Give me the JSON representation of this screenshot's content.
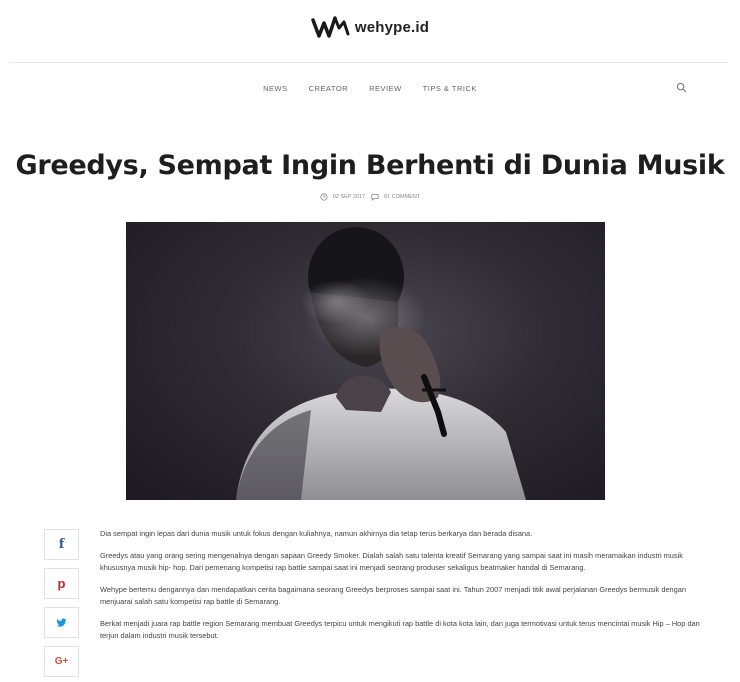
{
  "brand": {
    "logo_text": "wehype.id"
  },
  "nav": {
    "items": [
      "NEWS",
      "CREATOR",
      "REVIEW",
      "TIPS & TRICK"
    ],
    "search_icon": "search-icon"
  },
  "article": {
    "title": "Greedys, Sempat Ingin Berhenti di Dunia Musik",
    "date": "02 SEP 2017",
    "comments": "01 COMMENT",
    "paragraphs": [
      "Dia sempat ingin lepas dari dunia musik untuk fokus dengan kuliahnya, namun akhirnya dia tetap  terus berkarya dan berada disana.",
      "Greedys atau yang orang sering mengenalnya dengan sapaan Greedy Smoker. Dialah salah satu talenta kreatif Semarang yang sampai saat ini masih meramaikan industri musik khususnya musik hip- hop. Dari pemenang kompetisi rap battle sampai saat ini menjadi seorang produser sekaligus beatmaker handal di Semarang.",
      "Wehype bertemu dengannya dan mendapatkan cerita bagaimana seorang Greedys berproses sampai saat ini. Tahun 2007 menjadi titik awal perjalanan Greedys bermusik dengan menjuarai salah satu kompetisi rap battle di Semarang.",
      "Berkat menjadi juara rap battle region Semarang membuat Greedys terpicu untuk mengikuti rap battle di kota kota lain, dan juga termotivasi untuk terus mencintai musik Hip – Hop dan terjun dalam industri musik tersebut."
    ]
  },
  "share": {
    "facebook": "f",
    "pinterest": "p",
    "twitter": "t",
    "googleplus": "G+"
  }
}
